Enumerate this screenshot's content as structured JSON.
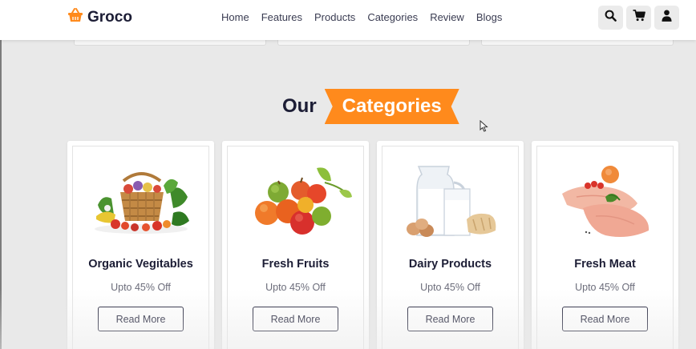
{
  "header": {
    "logo_text": "Groco",
    "nav": [
      "Home",
      "Features",
      "Products",
      "Categories",
      "Review",
      "Blogs"
    ],
    "icons": [
      "search-icon",
      "cart-icon",
      "user-icon"
    ]
  },
  "section": {
    "title_plain": "Our",
    "title_highlight": "Categories"
  },
  "categories": [
    {
      "title": "Organic Vegitables",
      "offer": "Upto 45% Off",
      "button": "Read More",
      "image": "vegetable-basket"
    },
    {
      "title": "Fresh Fruits",
      "offer": "Upto 45% Off",
      "button": "Read More",
      "image": "fruits"
    },
    {
      "title": "Dairy Products",
      "offer": "Upto 45% Off",
      "button": "Read More",
      "image": "milk-eggs-bread"
    },
    {
      "title": "Fresh Meat",
      "offer": "Upto 45% Off",
      "button": "Read More",
      "image": "raw-meat"
    }
  ],
  "colors": {
    "accent": "#ff8a1c",
    "dark": "#1c1d35",
    "background": "#e9e9e9"
  }
}
